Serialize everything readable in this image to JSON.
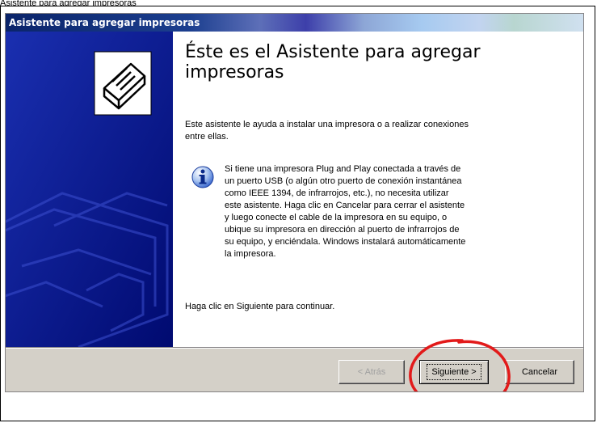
{
  "page": {
    "caption": "Asistente para agregar impresoras"
  },
  "window": {
    "title": "Asistente para agregar impresoras"
  },
  "content": {
    "heading": "Éste es el Asistente para agregar impresoras",
    "intro": "Este asistente le ayuda a instalar una impresora o a realizar conexiones entre ellas.",
    "info": "Si tiene una impresora Plug and Play conectada a través de un puerto USB (o algún otro puerto de conexión instantánea como IEEE 1394, de infrarrojos, etc.), no necesita utilizar este asistente. Haga clic en Cancelar para cerrar el asistente y luego conecte el cable de la impresora en su equipo, o ubique su impresora en dirección al puerto de infrarrojos de su equipo, y enciéndala. Windows instalará automáticamente la impresora.",
    "continue": "Haga clic en Siguiente para continuar."
  },
  "buttons": {
    "back": "< Atrás",
    "next": "Siguiente >",
    "cancel": "Cancelar"
  },
  "colors": {
    "side_panel": "#000e88",
    "annotation_circle": "#e21a1a"
  },
  "icons": {
    "wizard": "printer-icon",
    "info": "info-icon"
  }
}
